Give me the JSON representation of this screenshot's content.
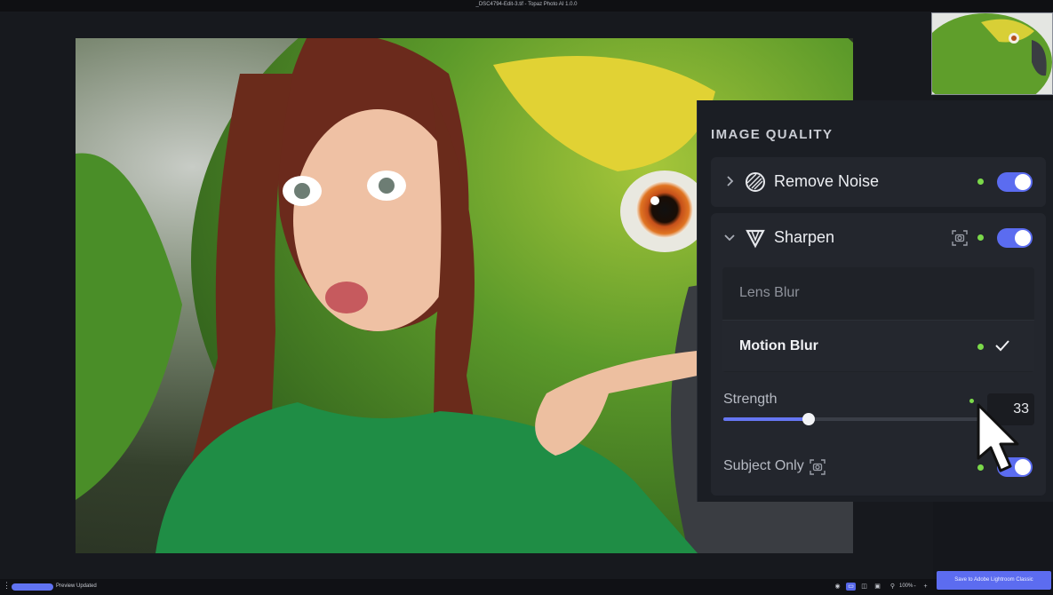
{
  "window": {
    "title": "_DSC4794-Edit-3.tif - Topaz Photo AI 1.0.0"
  },
  "panel": {
    "section_title": "IMAGE QUALITY",
    "filters": [
      {
        "label": "Remove Noise",
        "expanded": false,
        "enabled": true,
        "icon": "noise-icon"
      },
      {
        "label": "Sharpen",
        "expanded": true,
        "enabled": true,
        "icon": "sharpen-icon"
      }
    ],
    "sharpen": {
      "models": [
        {
          "label": "Lens Blur",
          "selected": false
        },
        {
          "label": "Motion Blur",
          "selected": true
        }
      ],
      "strength_label": "Strength",
      "strength_value": "33",
      "strength_fraction": 0.33,
      "subject_only_label": "Subject Only",
      "subject_only_enabled": true
    }
  },
  "status_bar": {
    "status_text": "Preview Updated",
    "zoom": "100%",
    "zoom_minus": "-",
    "zoom_plus": "+"
  },
  "save_button": {
    "label": "Save to Adobe Lightroom Classic"
  },
  "colors": {
    "accent": "#5b6cf0",
    "status_dot": "#7bd94a",
    "panel_bg": "#1b1e24"
  }
}
